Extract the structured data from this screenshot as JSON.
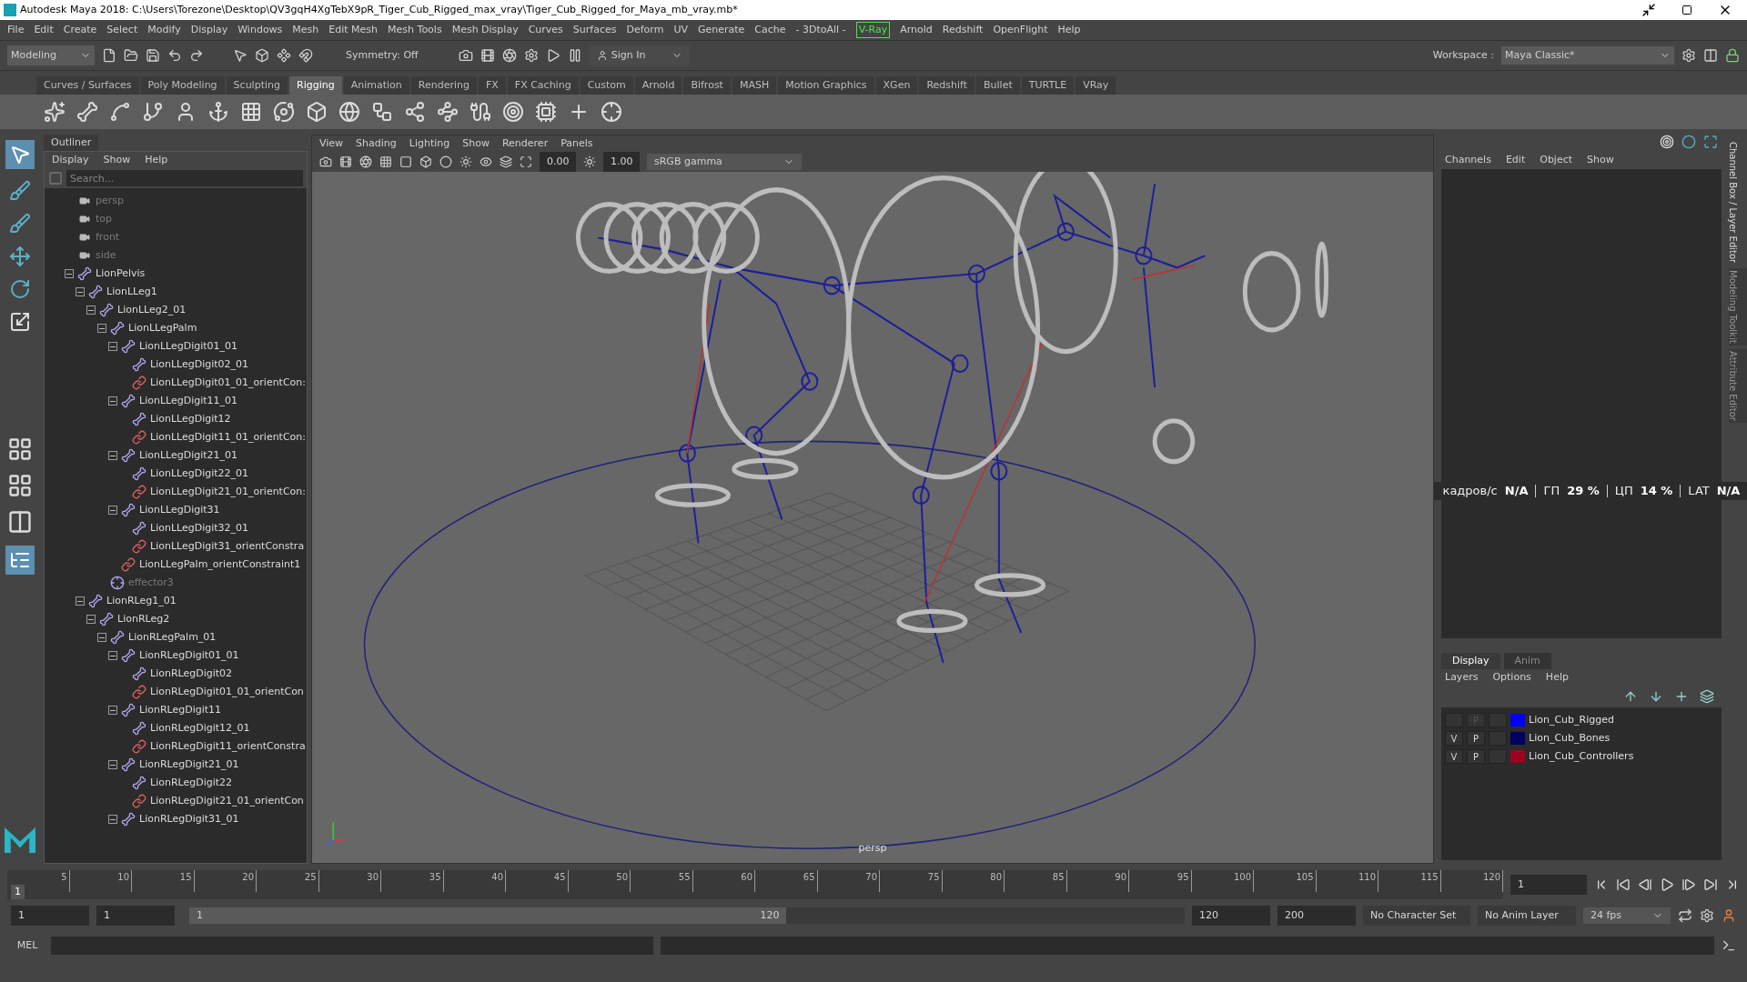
{
  "window": {
    "title": "Autodesk Maya 2018: C:\\Users\\Torezone\\Desktop\\QV3gqH4XgTebX9pR_Tiger_Cub_Rigged_max_vray\\Tiger_Cub_Rigged_for_Maya_mb_vray.mb*"
  },
  "menu": [
    {
      "label": "File",
      "kind": "plain"
    },
    {
      "label": "Edit",
      "kind": "plain"
    },
    {
      "label": "Create",
      "kind": "plain"
    },
    {
      "label": "Select",
      "kind": "plain"
    },
    {
      "label": "Modify",
      "kind": "plain"
    },
    {
      "label": "Display",
      "kind": "plain"
    },
    {
      "label": "Windows",
      "kind": "plain"
    },
    {
      "label": "Mesh",
      "kind": "plain"
    },
    {
      "label": "Edit Mesh",
      "kind": "plain"
    },
    {
      "label": "Mesh Tools",
      "kind": "plain"
    },
    {
      "label": "Mesh Display",
      "kind": "plain"
    },
    {
      "label": "Curves",
      "kind": "plain"
    },
    {
      "label": "Surfaces",
      "kind": "plain"
    },
    {
      "label": "Deform",
      "kind": "plain"
    },
    {
      "label": "UV",
      "kind": "plain"
    },
    {
      "label": "Generate",
      "kind": "plain"
    },
    {
      "label": "Cache",
      "kind": "plain"
    },
    {
      "label": "- 3DtoAll -",
      "kind": "plain"
    },
    {
      "label": "V-Ray",
      "kind": "boxed"
    },
    {
      "label": "Arnold",
      "kind": "plain"
    },
    {
      "label": "Redshift",
      "kind": "plain"
    },
    {
      "label": "OpenFlight",
      "kind": "plain"
    },
    {
      "label": "Help",
      "kind": "plain"
    }
  ],
  "status_line": {
    "mode": "Modeling",
    "symmetry": "Symmetry: Off",
    "sign_in": "Sign In",
    "workspace_label": "Workspace :",
    "workspace": "Maya Classic*"
  },
  "shelf_tabs": [
    {
      "label": "Curves / Surfaces",
      "selected": false
    },
    {
      "label": "Poly Modeling",
      "selected": false
    },
    {
      "label": "Sculpting",
      "selected": false
    },
    {
      "label": "Rigging",
      "selected": true
    },
    {
      "label": "Animation",
      "selected": false
    },
    {
      "label": "Rendering",
      "selected": false
    },
    {
      "label": "FX",
      "selected": false
    },
    {
      "label": "FX Caching",
      "selected": false
    },
    {
      "label": "Custom",
      "selected": false
    },
    {
      "label": "Arnold",
      "selected": false
    },
    {
      "label": "Bifrost",
      "selected": false
    },
    {
      "label": "MASH",
      "selected": false
    },
    {
      "label": "Motion Graphics",
      "selected": false
    },
    {
      "label": "XGen",
      "selected": false
    },
    {
      "label": "Redshift",
      "selected": false
    },
    {
      "label": "Bullet",
      "selected": false
    },
    {
      "label": "TURTLE",
      "selected": false
    },
    {
      "label": "VRay",
      "selected": false
    }
  ],
  "outliner": {
    "title": "Outliner",
    "menu": [
      "Display",
      "Show",
      "Help"
    ],
    "search": {
      "placeholder": "Search..."
    },
    "items": [
      {
        "name": "persp",
        "kind": "camera",
        "dimmed": true
      },
      {
        "name": "top",
        "kind": "camera",
        "dimmed": true
      },
      {
        "name": "front",
        "kind": "camera",
        "dimmed": true
      },
      {
        "name": "side",
        "kind": "camera",
        "dimmed": true
      },
      {
        "name": "LionPelvis",
        "kind": "joint",
        "dimmed": false,
        "expanded": true,
        "children": [
          {
            "name": "LionLLeg1",
            "kind": "joint",
            "dimmed": false,
            "expanded": true,
            "children": [
              {
                "name": "LionLLeg2_01",
                "kind": "joint",
                "dimmed": false,
                "expanded": true,
                "children": [
                  {
                    "name": "LionLLegPalm",
                    "kind": "joint",
                    "dimmed": false,
                    "expanded": true,
                    "children": [
                      {
                        "name": "LionLLegDigit01_01",
                        "kind": "joint",
                        "dimmed": false,
                        "expanded": true,
                        "children": [
                          {
                            "name": "LionLLegDigit02_01",
                            "kind": "joint",
                            "dimmed": false
                          },
                          {
                            "name": "LionLLegDigit01_01_orientCon:",
                            "kind": "constraint",
                            "dimmed": false
                          }
                        ]
                      },
                      {
                        "name": "LionLLegDigit11_01",
                        "kind": "joint",
                        "dimmed": false,
                        "expanded": true,
                        "children": [
                          {
                            "name": "LionLLegDigit12",
                            "kind": "joint",
                            "dimmed": false
                          },
                          {
                            "name": "LionLLegDigit11_01_orientCon:",
                            "kind": "constraint",
                            "dimmed": false
                          }
                        ]
                      },
                      {
                        "name": "LionLLegDigit21_01",
                        "kind": "joint",
                        "dimmed": false,
                        "expanded": true,
                        "children": [
                          {
                            "name": "LionLLegDigit22_01",
                            "kind": "joint",
                            "dimmed": false
                          },
                          {
                            "name": "LionLLegDigit21_01_orientCon:",
                            "kind": "constraint",
                            "dimmed": false
                          }
                        ]
                      },
                      {
                        "name": "LionLLegDigit31",
                        "kind": "joint",
                        "dimmed": false,
                        "expanded": true,
                        "children": [
                          {
                            "name": "LionLLegDigit32_01",
                            "kind": "joint",
                            "dimmed": false
                          },
                          {
                            "name": "LionLLegDigit31_orientConstra",
                            "kind": "constraint",
                            "dimmed": false
                          }
                        ]
                      },
                      {
                        "name": "LionLLegPalm_orientConstraint1",
                        "kind": "constraint",
                        "dimmed": false
                      }
                    ]
                  },
                  {
                    "name": "effector3",
                    "kind": "effector",
                    "dimmed": true
                  }
                ]
              }
            ]
          },
          {
            "name": "LionRLeg1_01",
            "kind": "joint",
            "dimmed": false,
            "expanded": true,
            "children": [
              {
                "name": "LionRLeg2",
                "kind": "joint",
                "dimmed": false,
                "expanded": true,
                "children": [
                  {
                    "name": "LionRLegPalm_01",
                    "kind": "joint",
                    "dimmed": false,
                    "expanded": true,
                    "children": [
                      {
                        "name": "LionRLegDigit01_01",
                        "kind": "joint",
                        "dimmed": false,
                        "expanded": true,
                        "children": [
                          {
                            "name": "LionRLegDigit02",
                            "kind": "joint",
                            "dimmed": false
                          },
                          {
                            "name": "LionRLegDigit01_01_orientCon",
                            "kind": "constraint",
                            "dimmed": false
                          }
                        ]
                      },
                      {
                        "name": "LionRLegDigit11",
                        "kind": "joint",
                        "dimmed": false,
                        "expanded": true,
                        "children": [
                          {
                            "name": "LionRLegDigit12_01",
                            "kind": "joint",
                            "dimmed": false
                          },
                          {
                            "name": "LionRLegDigit11_orientConstra",
                            "kind": "constraint",
                            "dimmed": false
                          }
                        ]
                      },
                      {
                        "name": "LionRLegDigit21_01",
                        "kind": "joint",
                        "dimmed": false,
                        "expanded": true,
                        "children": [
                          {
                            "name": "LionRLegDigit22",
                            "kind": "joint",
                            "dimmed": false
                          },
                          {
                            "name": "LionRLegDigit21_01_orientCon",
                            "kind": "constraint",
                            "dimmed": false
                          }
                        ]
                      },
                      {
                        "name": "LionRLegDigit31_01",
                        "kind": "joint",
                        "dimmed": false,
                        "expanded": true
                      }
                    ]
                  }
                ]
              }
            ]
          }
        ]
      }
    ]
  },
  "viewport": {
    "menu": [
      "View",
      "Shading",
      "Lighting",
      "Show",
      "Renderer",
      "Panels"
    ],
    "near": "0.00",
    "gamma_value": "1.00",
    "color_space": "sRGB gamma",
    "camera_label": "persp",
    "hud": [
      {
        "label": "кадров/с",
        "value": "N/A"
      },
      {
        "label": "ГП",
        "value": "29 %"
      },
      {
        "label": "ЦП",
        "value": "14 %"
      },
      {
        "label": "LAT",
        "value": "N/A"
      }
    ]
  },
  "channel_box": {
    "menu": [
      "Channels",
      "Edit",
      "Object",
      "Show"
    ]
  },
  "side_tabs": [
    {
      "label": "Channel Box / Layer Editor",
      "selected": true
    },
    {
      "label": "Modeling Toolkit",
      "selected": false
    },
    {
      "label": "Attribute Editor",
      "selected": false
    }
  ],
  "layer_editor": {
    "tabs": [
      {
        "label": "Display",
        "selected": true
      },
      {
        "label": "Anim",
        "selected": false
      }
    ],
    "menu": [
      "Layers",
      "Options",
      "Help"
    ],
    "layers": [
      {
        "name": "Lion_Cub_Rigged",
        "color": "#0000ff",
        "p": "P",
        "p_dim": true
      },
      {
        "name": "Lion_Cub_Bones",
        "color": "#000060",
        "v": "V",
        "p": "P",
        "p_dim": false
      },
      {
        "name": "Lion_Cub_Controllers",
        "color": "#a00020",
        "v": "V",
        "p": "P",
        "p_dim": false
      }
    ]
  },
  "timeline": {
    "current_frame": "1",
    "level": 0,
    "ticks": [
      "5",
      "10",
      "15",
      "20",
      "25",
      "30",
      "35",
      "40",
      "45",
      "50",
      "55",
      "60",
      "65",
      "70",
      "75",
      "80",
      "85",
      "90",
      "95",
      "100",
      "105",
      "110",
      "115",
      "120"
    ],
    "frame_field": "1"
  },
  "range": {
    "level": 0.6,
    "start": "1",
    "playback_start": "1",
    "slider_start": "1",
    "slider_end": "120",
    "playback_end": "120",
    "end": "200",
    "character_set": "No Character Set",
    "anim_layer": "No Anim Layer",
    "fps": "24 fps"
  },
  "command_line": {
    "language": "MEL"
  }
}
